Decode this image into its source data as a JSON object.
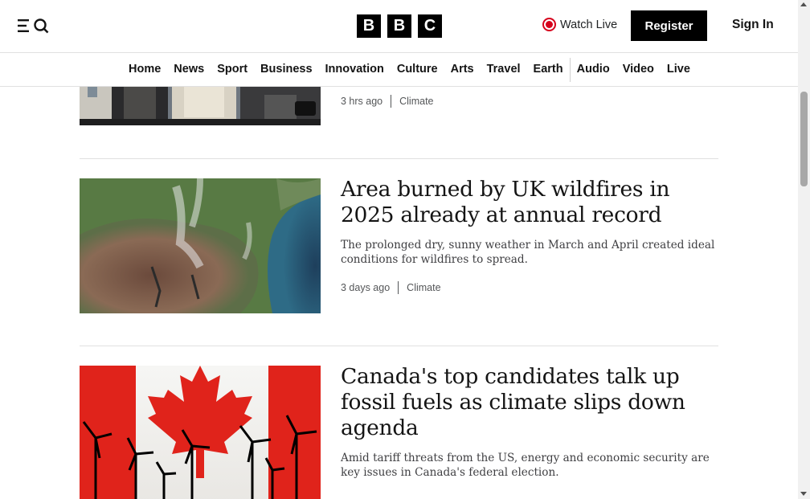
{
  "header": {
    "logo_letters": [
      "B",
      "B",
      "C"
    ],
    "watch_live": "Watch Live",
    "register": "Register",
    "sign_in": "Sign In"
  },
  "nav": {
    "items": [
      "Home",
      "News",
      "Sport",
      "Business",
      "Innovation",
      "Culture",
      "Arts",
      "Travel",
      "Earth",
      "Audio",
      "Video",
      "Live"
    ]
  },
  "stories": [
    {
      "time": "3 hrs ago",
      "topic": "Climate"
    },
    {
      "headline": "Area burned by UK wildfires in 2025 already at annual record",
      "summary": "The prolonged dry, sunny weather in March and April created ideal conditions for wildfires to spread.",
      "time": "3 days ago",
      "topic": "Climate"
    },
    {
      "headline": "Canada's top candidates talk up fossil fuels as climate slips down agenda",
      "summary": "Amid tariff threats from the US, energy and economic security are key issues in Canada's federal election."
    }
  ],
  "colors": {
    "brand_black": "#000000",
    "live_red": "#d6001c",
    "text": "#141414",
    "meta": "#545658"
  }
}
